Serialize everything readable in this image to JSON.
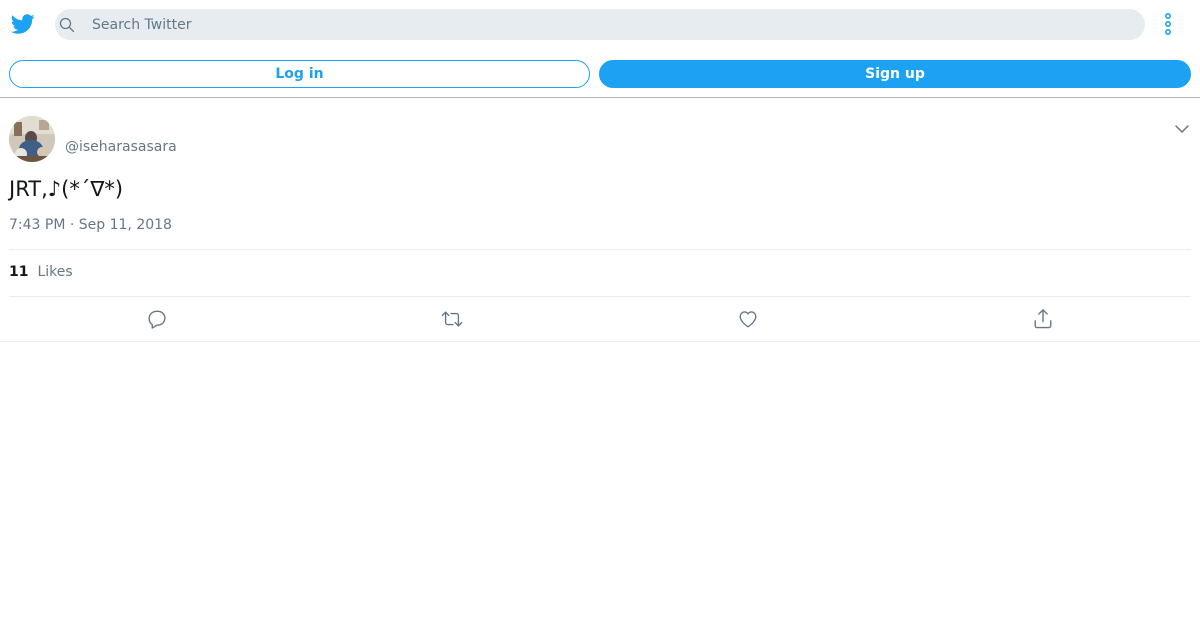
{
  "header": {
    "search_placeholder": "Search Twitter",
    "login_label": "Log in",
    "signup_label": "Sign up"
  },
  "tweet": {
    "handle": "@iseharasasara",
    "text": "JRT,♪(*´∇*)",
    "timestamp": "7:43 PM · Sep 11, 2018",
    "likes_count": "11",
    "likes_label": "Likes"
  },
  "icons": {
    "logo": "twitter-bird-icon",
    "search": "search-icon",
    "more": "more-vertical-icon",
    "caret": "chevron-down-icon",
    "reply": "reply-icon",
    "retweet": "retweet-icon",
    "like": "heart-icon",
    "share": "share-icon"
  },
  "colors": {
    "accent": "#1da1f2",
    "text": "#14171a",
    "secondary_text": "#657786",
    "search_bg": "#e6ecf0"
  }
}
